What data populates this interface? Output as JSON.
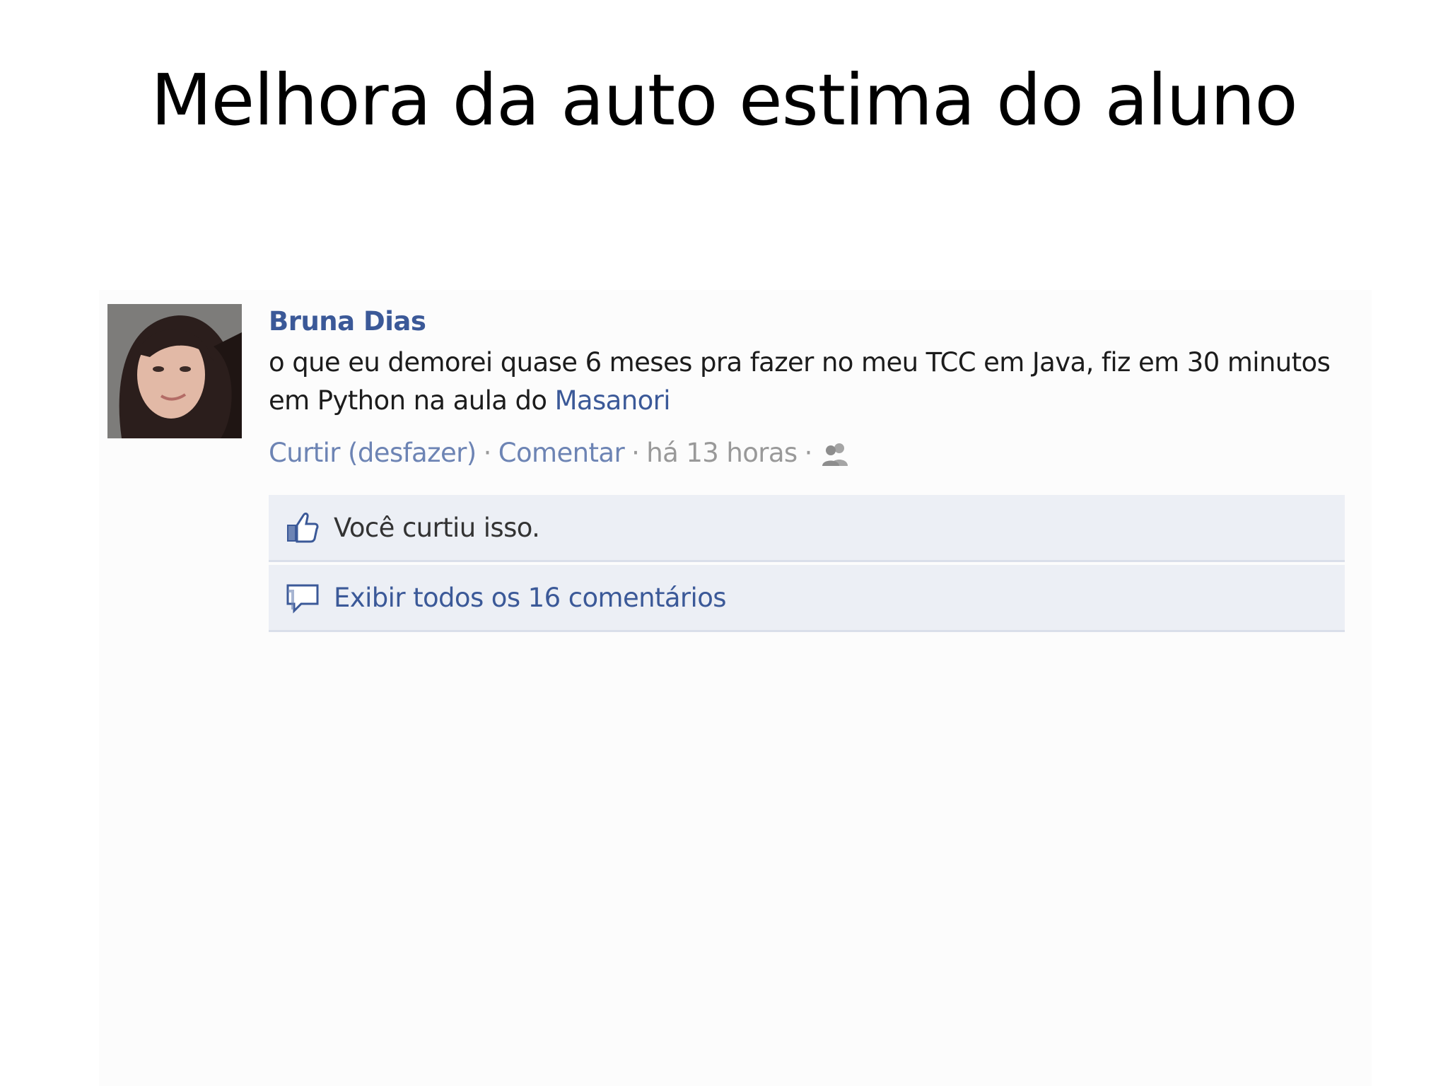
{
  "slide": {
    "title": "Melhora da auto estima do aluno"
  },
  "post": {
    "author": "Bruna Dias",
    "message_text": "o que eu demorei quase 6 meses pra fazer no meu TCC em Java, fiz em 30 minutos em Python na aula do ",
    "mention": "Masanori",
    "actions": {
      "like": "Curtir (desfazer)",
      "comment": "Comentar",
      "separator": "·",
      "timestamp": "há 13 horas"
    },
    "audience_icon": "friends-icon"
  },
  "ufi": {
    "likes_text": "Você curtiu isso.",
    "likes_icon": "thumbs-up-icon",
    "comments_text": "Exibir todos os 16 comentários",
    "comments_icon": "comment-bubble-icon"
  },
  "colors": {
    "link_blue": "#3b5998",
    "action_blue": "#6d84b4",
    "ufi_background": "#eceff5",
    "meta_gray": "#999999"
  }
}
